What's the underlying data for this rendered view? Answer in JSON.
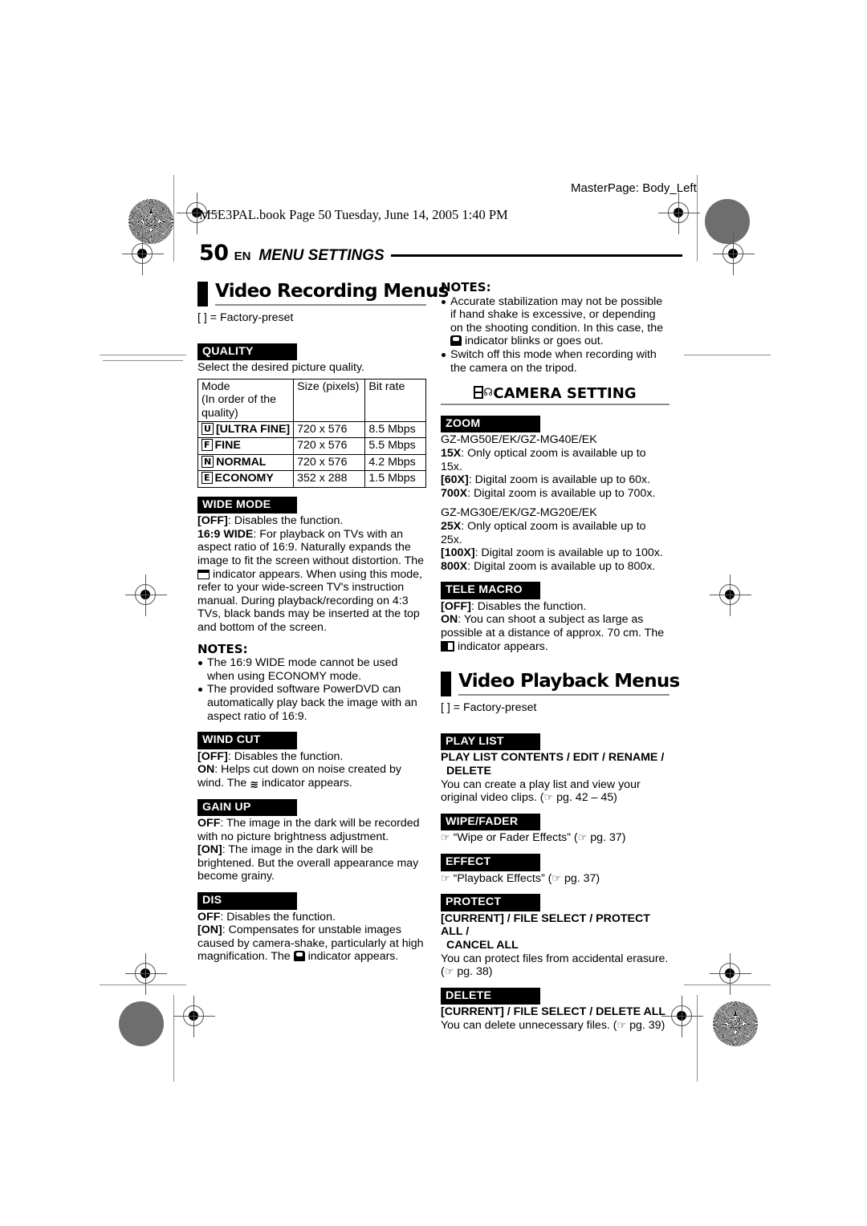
{
  "print_marks": {
    "masterpage_label": "MasterPage: Body_Left",
    "book_line": "M5E3PAL.book  Page 50  Tuesday, June 14, 2005  1:40 PM"
  },
  "page_header": {
    "page_number": "50",
    "language": "EN",
    "section": "MENU SETTINGS"
  },
  "left_column": {
    "chapter": "Video Recording Menus",
    "preset_note": "[  ] = Factory-preset",
    "quality": {
      "label": "QUALITY",
      "intro": "Select the desired picture quality.",
      "table": {
        "headers": [
          "Mode\n(In order of the\nquality)",
          "Size (pixels)",
          "Bit rate"
        ],
        "header_mode": "Mode",
        "header_mode_sub1": "(In order of the",
        "header_mode_sub2": "quality)",
        "header_size": "Size (pixels)",
        "header_bitrate": "Bit rate",
        "rows": [
          {
            "icon": "U",
            "mode": "[ULTRA FINE]",
            "size": "720 x 576",
            "bitrate": "8.5 Mbps"
          },
          {
            "icon": "F",
            "mode": "FINE",
            "size": "720 x 576",
            "bitrate": "5.5 Mbps"
          },
          {
            "icon": "N",
            "mode": "NORMAL",
            "size": "720 x 576",
            "bitrate": "4.2 Mbps"
          },
          {
            "icon": "E",
            "mode": "ECONOMY",
            "size": "352 x 288",
            "bitrate": "1.5 Mbps"
          }
        ]
      }
    },
    "wide_mode": {
      "label": "WIDE MODE",
      "off_bold": "[OFF]",
      "off_text": ": Disables the function.",
      "wide_bold": "16:9 WIDE",
      "wide_text_1": ": For playback on TVs with an aspect ratio of 16:9. Naturally expands the image to fit the screen without distortion. The ",
      "wide_text_2": " indicator appears. When using this mode, refer to your wide-screen TV's instruction manual. During playback/recording on 4:3 TVs, black bands may be inserted at the top and bottom of the screen.",
      "notes_title": "NOTES:",
      "notes": [
        "The 16:9 WIDE mode cannot be used when using ECONOMY mode.",
        "The provided software PowerDVD can automatically play back the image with an aspect ratio of 16:9."
      ]
    },
    "wind_cut": {
      "label": "WIND CUT",
      "off_bold": "[OFF]",
      "off_text": ": Disables the function.",
      "on_bold": "ON",
      "on_text_1": ": Helps cut down on noise created by wind. The ",
      "on_text_2": " indicator appears."
    },
    "gain_up": {
      "label": "GAIN UP",
      "off_bold": "OFF",
      "off_text": ": The image in the dark will be recorded with no picture brightness adjustment.",
      "on_bold": "[ON]",
      "on_text": ": The image in the dark will be brightened. But the overall appearance may become grainy."
    },
    "dis": {
      "label": "DIS",
      "off_bold": "OFF",
      "off_text": ": Disables the function.",
      "on_bold": "[ON]",
      "on_text_1": ": Compensates for unstable images caused by camera-shake, particularly at high magnification. The ",
      "on_text_2": " indicator appears."
    }
  },
  "right_column": {
    "dis_notes": {
      "title": "NOTES:",
      "items_1_a": "Accurate stabilization may not be possible if hand shake is excessive, or depending on the shooting condition. In this case, the ",
      "items_1_b": " indicator blinks or goes out.",
      "item_2": "Switch off this mode when recording with the camera on the tripod."
    },
    "camera_setting": {
      "title": "CAMERA SETTING",
      "icon": "camcorder-icon"
    },
    "zoom": {
      "label": "ZOOM",
      "group1_models": "GZ-MG50E/EK/GZ-MG40E/EK",
      "group1_lines": [
        {
          "bold": "15X",
          "text": ": Only optical zoom is available up to 15x."
        },
        {
          "bold": "[60X]",
          "text": ": Digital zoom is available up to 60x."
        },
        {
          "bold": "700X",
          "text": ": Digital zoom is available up to 700x."
        }
      ],
      "group2_models": "GZ-MG30E/EK/GZ-MG20E/EK",
      "group2_lines": [
        {
          "bold": "25X",
          "text": ": Only optical zoom is available up to 25x."
        },
        {
          "bold": "[100X]",
          "text": ": Digital zoom is available up to 100x."
        },
        {
          "bold": "800X",
          "text": ": Digital zoom is available up to 800x."
        }
      ]
    },
    "tele_macro": {
      "label": "TELE MACRO",
      "off_bold": "[OFF]",
      "off_text": ": Disables the function.",
      "on_bold": "ON",
      "on_text_1": ": You can shoot a subject as large as possible at a distance of approx. 70 cm. The ",
      "on_text_2": " indicator appears."
    },
    "chapter": "Video Playback Menus",
    "preset_note": "[  ] = Factory-preset",
    "play_list": {
      "label": "PLAY LIST",
      "sub_line1": "PLAY LIST CONTENTS / EDIT / RENAME /",
      "sub_line2": "DELETE",
      "text": "You can create a play list and view your original video clips. (",
      "ref": " pg. 42 – 45)"
    },
    "wipe_fader": {
      "label": "WIPE/FADER",
      "text": " “Wipe or Fader Effects” (",
      "ref": " pg. 37)"
    },
    "effect": {
      "label": "EFFECT",
      "text": " “Playback Effects” (",
      "ref": " pg. 37)"
    },
    "protect": {
      "label": "PROTECT",
      "sub_line1": "[CURRENT] / FILE SELECT / PROTECT ALL /",
      "sub_line2": "CANCEL ALL",
      "text": "You can protect files from accidental erasure.",
      "ref_open": "(",
      "ref": " pg. 38)"
    },
    "delete": {
      "label": "DELETE",
      "sub_line1": "[CURRENT] / FILE SELECT / DELETE ALL",
      "text": "You can delete unnecessary files. (",
      "ref": " pg. 39)"
    }
  }
}
